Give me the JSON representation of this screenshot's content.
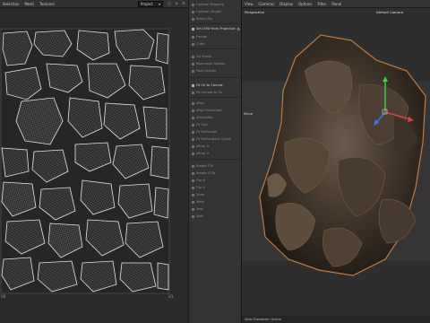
{
  "uv_editor": {
    "menu": [
      "Selection",
      "Mesh",
      "Textures"
    ],
    "projection_select": "Project",
    "bottom_left_label": "V0",
    "bottom_right_label": "U1"
  },
  "panel": {
    "items": [
      {
        "label": "Optimal Mapping"
      },
      {
        "label": "Optimal (Angle)"
      },
      {
        "label": "Relax UVs"
      },
      {
        "label": "Set UVW from Projection",
        "highlight": true,
        "gear": true
      },
      {
        "label": "Frontal"
      },
      {
        "label": "Cubic"
      },
      {
        "label": "UV Shells"
      },
      {
        "label": "Rearrange Islands"
      },
      {
        "label": "Pack Islands"
      },
      {
        "label": "Fit UV to Canvas",
        "highlight": true
      },
      {
        "label": "Fit Canvas to UV"
      },
      {
        "label": "Align"
      },
      {
        "label": "Align Horizontal"
      },
      {
        "label": "Straighten"
      },
      {
        "label": "Fit Size"
      },
      {
        "label": "Fit Rectangle"
      },
      {
        "label": "Fit Rectangular Guide"
      },
      {
        "label": "Mirror U"
      },
      {
        "label": "Mirror V"
      },
      {
        "label": "Rotate CW"
      },
      {
        "label": "Rotate CCW"
      },
      {
        "label": "Flip H"
      },
      {
        "label": "Flip V"
      },
      {
        "label": "Snap"
      },
      {
        "label": "Weld"
      },
      {
        "label": "Sew"
      },
      {
        "label": "Split"
      }
    ]
  },
  "viewport": {
    "menu": [
      "View",
      "Cameras",
      "Display",
      "Options",
      "Filter",
      "Panel"
    ],
    "view_name": "Perspective",
    "camera_name": "Default Camera",
    "side_label": "Move",
    "status": "View Transform: Scene"
  }
}
